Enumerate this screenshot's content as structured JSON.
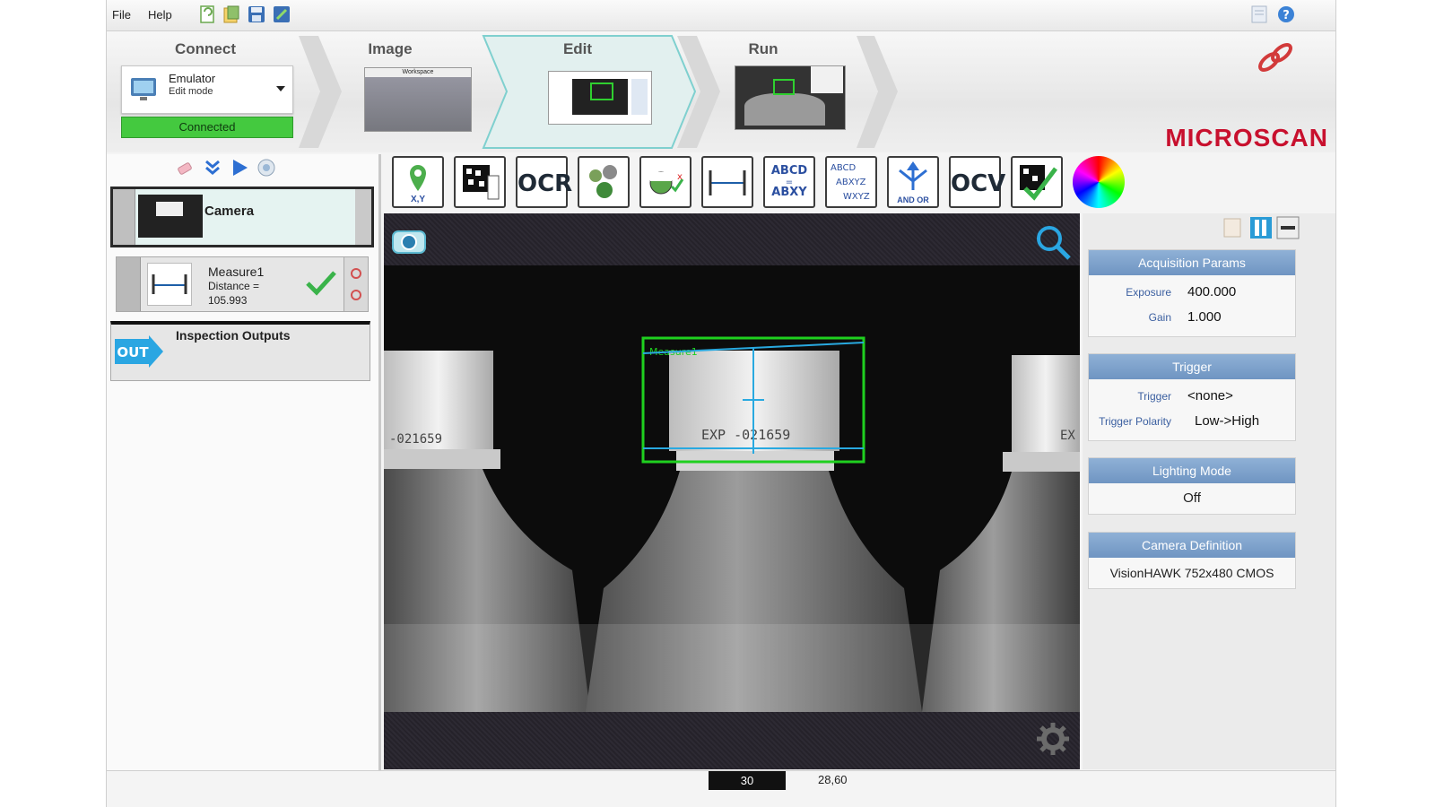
{
  "menu": {
    "file": "File",
    "help": "Help"
  },
  "workflow": {
    "steps": [
      {
        "label": "Connect"
      },
      {
        "label": "Image"
      },
      {
        "label": "Edit"
      },
      {
        "label": "Run"
      }
    ],
    "device_name": "Emulator",
    "device_mode": "Edit mode",
    "status": "Connected",
    "brand": "MICROSCAN",
    "image_thumb_caption": "Workspace"
  },
  "inspection": {
    "camera_label": "Camera",
    "measure": {
      "name": "Measure1",
      "line1": "Distance =",
      "line2": "105.993"
    },
    "outputs_label": "Inspection Outputs",
    "out_badge": "OUT"
  },
  "tools": {
    "locate": "X,Y",
    "ocr": "OCR",
    "ocv": "OCV",
    "and_or": "AND OR"
  },
  "image": {
    "roi_caption": "Measure1",
    "bottle_text_center": "EXP -021659",
    "bottle_text_left": "-021659",
    "bottle_text_right": "EX"
  },
  "params": {
    "acquisition": {
      "title": "Acquisition Params",
      "exposure_label": "Exposure",
      "exposure": "400.000",
      "gain_label": "Gain",
      "gain": "1.000"
    },
    "trigger": {
      "title": "Trigger",
      "trigger_label": "Trigger",
      "trigger": "<none>",
      "polarity_label": "Trigger Polarity",
      "polarity": "Low->High"
    },
    "lighting": {
      "title": "Lighting Mode",
      "value": "Off"
    },
    "camera": {
      "title": "Camera Definition",
      "value": "VisionHAWK 752x480 CMOS"
    }
  },
  "status_bar": {
    "value": "30",
    "coords": "28,60"
  },
  "colors": {
    "accent_blue": "#6f95c2",
    "connected_green": "#44c93f",
    "brand_red": "#c8102e",
    "roi_green": "#1fd01f"
  }
}
